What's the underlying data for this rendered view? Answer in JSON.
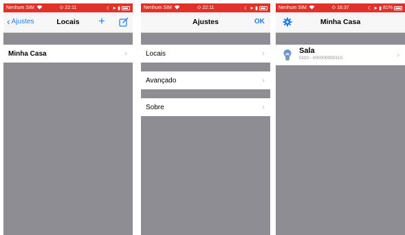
{
  "screen1": {
    "status": {
      "carrier": "Nenhum SIM",
      "time": "22:11",
      "battery_level": 0.75
    },
    "nav": {
      "back_label": "Ajustes",
      "title": "Locais",
      "plus": "+"
    },
    "items": [
      {
        "label": "Minha Casa"
      }
    ]
  },
  "screen2": {
    "status": {
      "carrier": "Nenhum SIM",
      "time": "22:11",
      "battery_level": 0.75
    },
    "nav": {
      "title": "Ajustes",
      "ok_label": "OK"
    },
    "items": [
      {
        "label": "Locais"
      },
      {
        "label": "Avançado"
      },
      {
        "label": "Sobre"
      }
    ]
  },
  "screen3": {
    "status": {
      "carrier": "Nenhum SIM",
      "time": "16:37",
      "battery_text": "81%",
      "battery_level": 0.81
    },
    "nav": {
      "title": "Minha Casa"
    },
    "device": {
      "name": "Sala",
      "code": "0110 - 000000000310"
    }
  },
  "colors": {
    "status_bar": "#e0312b",
    "accent": "#1a7cf5",
    "background": "#8e8d93"
  }
}
